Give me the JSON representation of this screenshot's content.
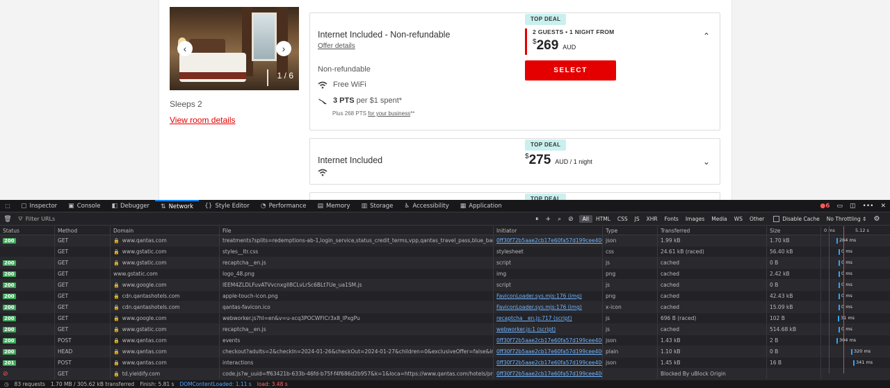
{
  "room": {
    "photo_counter": "1 / 6",
    "sleeps": "Sleeps 2",
    "view_details": "View room details"
  },
  "offers": [
    {
      "badge": "TOP DEAL",
      "title": "Internet Included - Non-refundable",
      "details_link": "Offer details",
      "guests": "2 GUESTS • 1 NIGHT FROM",
      "currency_symbol": "$",
      "amount": "269",
      "currency": "AUD",
      "select": "SELECT",
      "cancellation": "Non-refundable",
      "wifi": "Free WiFi",
      "pts_bold": "3 PTS",
      "pts_rest": "per $1 spent*",
      "plus_pts_prefix": "Plus 268 PTS",
      "plus_pts_link": "for your business",
      "plus_pts_suffix": "**"
    },
    {
      "badge": "TOP DEAL",
      "title": "Internet Included",
      "currency_symbol": "$",
      "amount": "275",
      "currency": "AUD / 1 night"
    },
    {
      "badge": "TOP DEAL"
    }
  ],
  "devtools": {
    "tabs": [
      {
        "label": "Inspector",
        "icon": "inspector-icon",
        "glyph": "▢"
      },
      {
        "label": "Console",
        "icon": "console-icon",
        "glyph": "▣"
      },
      {
        "label": "Debugger",
        "icon": "debugger-icon",
        "glyph": "◧"
      },
      {
        "label": "Network",
        "icon": "network-icon",
        "glyph": "⇅"
      },
      {
        "label": "Style Editor",
        "icon": "style-editor-icon",
        "glyph": "{}"
      },
      {
        "label": "Performance",
        "icon": "performance-icon",
        "glyph": "◔"
      },
      {
        "label": "Memory",
        "icon": "memory-icon",
        "glyph": "▤"
      },
      {
        "label": "Storage",
        "icon": "storage-icon",
        "glyph": "▥"
      },
      {
        "label": "Accessibility",
        "icon": "accessibility-icon",
        "glyph": "♿"
      },
      {
        "label": "Application",
        "icon": "application-icon",
        "glyph": "▦"
      }
    ],
    "active_tab": "Network",
    "error_count": "6",
    "filter_placeholder": "Filter URLs",
    "type_filters": [
      "All",
      "HTML",
      "CSS",
      "JS",
      "XHR",
      "Fonts",
      "Images",
      "Media",
      "WS",
      "Other"
    ],
    "disable_cache": "Disable Cache",
    "throttling": "No Throttling ⇕",
    "columns": [
      "Status",
      "Method",
      "Domain",
      "File",
      "Initiator",
      "Type",
      "Transferred",
      "Size"
    ],
    "waterfall_ticks": [
      "0 ms",
      "5.12 s"
    ],
    "rows": [
      {
        "status": "200",
        "method": "GET",
        "domain": "www.qantas.com",
        "lock": true,
        "file": "treatments?splits=redemptions-ab-1,login_service,status_credit_terms,vpp,qantas_travel_pass,blue_banner_messa",
        "initiator": "0ff30f72b5aae2cb17e60fa57d199cee4001...",
        "init_link": true,
        "type": "json",
        "transferred": "1.99 kB",
        "size": "1.70 kB",
        "wf": "284 ms"
      },
      {
        "status": "",
        "method": "GET",
        "domain": "www.gstatic.com",
        "lock": true,
        "file": "styles__ltr.css",
        "initiator": "stylesheet",
        "init_link": false,
        "type": "css",
        "transferred": "24.61 kB (raced)",
        "size": "56.40 kB",
        "wf": "0 ms"
      },
      {
        "status": "200",
        "method": "GET",
        "domain": "www.gstatic.com",
        "lock": true,
        "file": "recaptcha__en.js",
        "initiator": "script",
        "init_link": false,
        "type": "js",
        "transferred": "cached",
        "size": "0 B",
        "wf": "0 ms"
      },
      {
        "status": "200",
        "method": "GET",
        "domain": "www.gstatic.com",
        "lock": false,
        "file": "logo_48.png",
        "initiator": "img",
        "init_link": false,
        "type": "png",
        "transferred": "cached",
        "size": "2.42 kB",
        "wf": "0 ms"
      },
      {
        "status": "200",
        "method": "GET",
        "domain": "www.google.com",
        "lock": true,
        "file": "IEEM4ZLDLFuvATVvcnxgIl8CLvLrSc6BLt7Ue_ua1SM.js",
        "initiator": "script",
        "init_link": false,
        "type": "js",
        "transferred": "cached",
        "size": "0 B",
        "wf": "0 ms"
      },
      {
        "status": "200",
        "method": "GET",
        "domain": "cdn.qantashotels.com",
        "lock": true,
        "file": "apple-touch-icon.png",
        "initiator": "FaviconLoader.sys.mjs:176 (img)",
        "init_link": true,
        "type": "png",
        "transferred": "cached",
        "size": "42.43 kB",
        "wf": "0 ms"
      },
      {
        "status": "200",
        "method": "GET",
        "domain": "cdn.qantashotels.com",
        "lock": true,
        "file": "qantas-favicon.ico",
        "initiator": "FaviconLoader.sys.mjs:176 (img)",
        "init_link": true,
        "type": "x-icon",
        "transferred": "cached",
        "size": "15.09 kB",
        "wf": "0 ms"
      },
      {
        "status": "200",
        "method": "GET",
        "domain": "www.google.com",
        "lock": true,
        "file": "webworker.js?hl=en&v=u-xcq3POCWFlCr3x8_lPxgPu",
        "initiator": "recaptcha__en.js:717 (script)",
        "init_link": true,
        "type": "js",
        "transferred": "696 B (raced)",
        "size": "102 B",
        "wf": "31 ms"
      },
      {
        "status": "200",
        "method": "GET",
        "domain": "www.gstatic.com",
        "lock": true,
        "file": "recaptcha__en.js",
        "initiator": "webworker.js:1 (script)",
        "init_link": true,
        "type": "js",
        "transferred": "cached",
        "size": "514.68 kB",
        "wf": "0 ms"
      },
      {
        "status": "200",
        "method": "POST",
        "domain": "www.qantas.com",
        "lock": true,
        "file": "events",
        "initiator": "0ff30f72b5aae2cb17e60fa57d199cee4001...",
        "init_link": true,
        "type": "json",
        "transferred": "1.43 kB",
        "size": "2 B",
        "wf": "304 ms"
      },
      {
        "status": "200",
        "method": "HEAD",
        "domain": "www.qantas.com",
        "lock": true,
        "file": "checkout?adults=2&checkIn=2024-01-26&checkOut=2024-01-27&children=0&exclusiveOffer=false&infants=0&offe",
        "initiator": "0ff30f72b5aae2cb17e60fa57d199cee4001...",
        "init_link": true,
        "type": "plain",
        "transferred": "1.10 kB",
        "size": "0 B",
        "wf": "320 ms"
      },
      {
        "status": "201",
        "method": "POST",
        "domain": "www.qantas.com",
        "lock": true,
        "file": "interactions",
        "initiator": "0ff30f72b5aae2cb17e60fa57d199cee4001...",
        "init_link": true,
        "type": "json",
        "transferred": "1.45 kB",
        "size": "16 B",
        "wf": "341 ms"
      },
      {
        "status": "blocked",
        "method": "GET",
        "domain": "td.yieldify.com",
        "lock": true,
        "file": "code.js?w_uuid=ff63421b-633b-46fd-b75f-f4f686d2b957&k=1&loca=https://www.qantas.com/hotels/properties/18",
        "initiator": "0ff30f72b5aae2cb17e60fa57d199cee4001...",
        "init_link": true,
        "type": "",
        "transferred": "Blocked By uBlock Origin",
        "size": "",
        "wf": ""
      }
    ],
    "status_bar": {
      "requests": "83 requests",
      "transferred": "1.70 MB / 305.62 kB transferred",
      "finish": "Finish: 5.81 s",
      "dom": "DOMContentLoaded: 1.11 s",
      "load": "load: 3.48 s"
    }
  }
}
